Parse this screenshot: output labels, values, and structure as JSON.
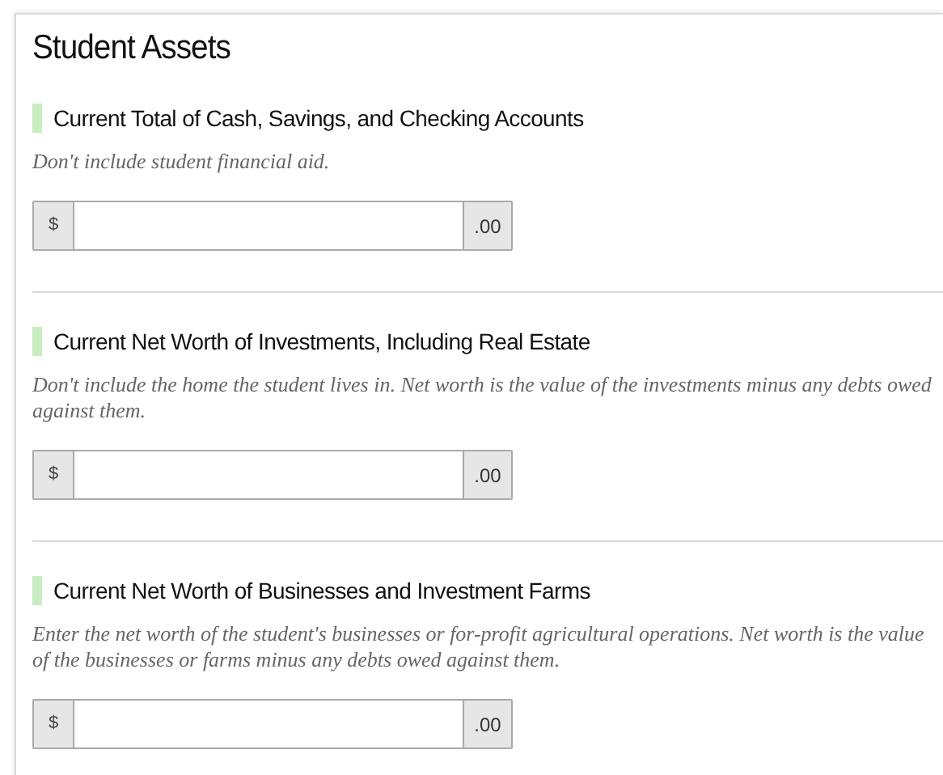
{
  "title": "Student Assets",
  "sections": [
    {
      "heading": "Current Total of Cash, Savings, and Checking Accounts",
      "hint": "Don't include student financial aid.",
      "prefix": "$",
      "suffix": ".00"
    },
    {
      "heading": "Current Net Worth of Investments, Including Real Estate",
      "hint": "Don't include the home the student lives in. Net worth is the value of the investments minus any debts owed against them.",
      "prefix": "$",
      "suffix": ".00"
    },
    {
      "heading": "Current Net Worth of Businesses and Investment Farms",
      "hint": "Enter the net worth of the student's businesses or for-profit agricultural operations. Net worth is the value of the businesses or farms minus any debts owed against them.",
      "prefix": "$",
      "suffix": ".00"
    }
  ]
}
